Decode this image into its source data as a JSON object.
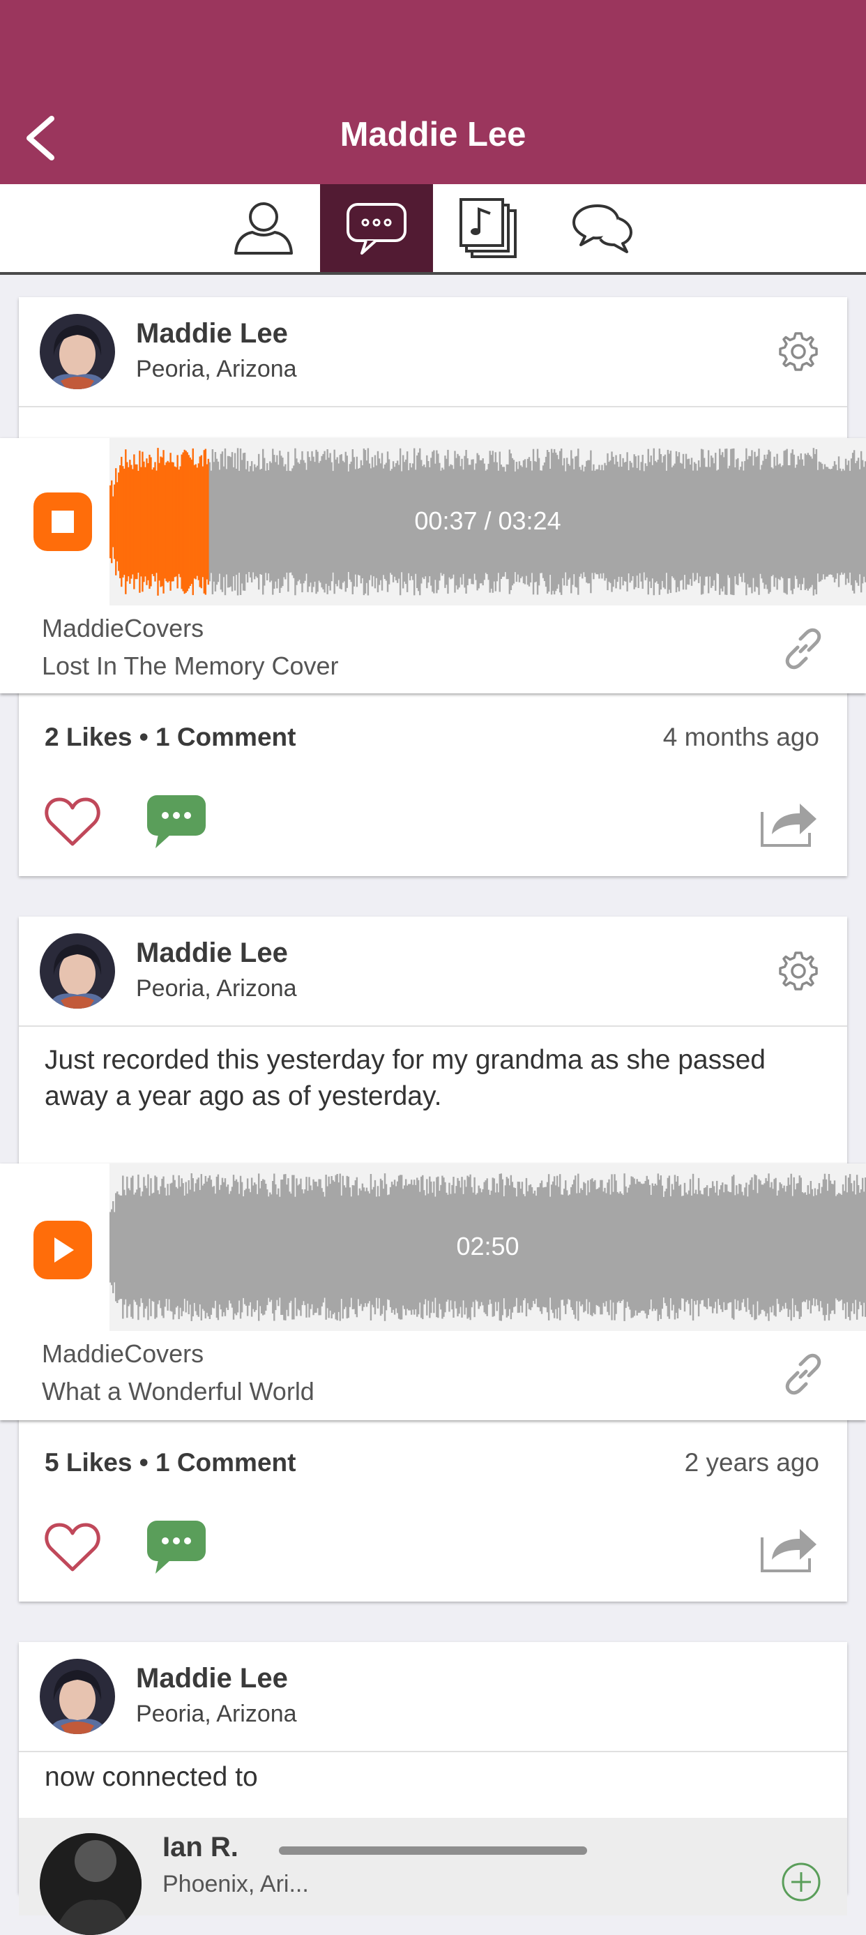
{
  "header": {
    "title": "Maddie Lee"
  },
  "tabs": [
    {
      "icon": "profile-icon"
    },
    {
      "icon": "speech-bubble-icon"
    },
    {
      "icon": "music-library-icon"
    },
    {
      "icon": "chat-bubbles-icon"
    }
  ],
  "posts": [
    {
      "author": "Maddie Lee",
      "location": "Peoria, Arizona",
      "audio": {
        "time": "00:37 / 03:24",
        "artist": "MaddieCovers",
        "title": "Lost In The Memory Cover",
        "state": "playing",
        "progress": 0.13
      },
      "stats": "2 Likes • 1 Comment",
      "time_ago": "4 months ago"
    },
    {
      "author": "Maddie Lee",
      "location": "Peoria, Arizona",
      "text": "Just recorded this yesterday for my grandma as she passed away a year ago as of yesterday.",
      "audio": {
        "time": "02:50",
        "artist": "MaddieCovers",
        "title": "What a Wonderful World",
        "state": "paused",
        "progress": 0
      },
      "stats": "5 Likes • 1 Comment",
      "time_ago": "2 years ago"
    },
    {
      "author": "Maddie Lee",
      "location": "Peoria, Arizona",
      "text": "now connected to",
      "connection": {
        "name": "Ian R.",
        "location": "Phoenix, Ari..."
      }
    }
  ],
  "colors": {
    "header": "#9b365d",
    "tab_active": "#521b33",
    "accent_orange": "#ff6d0a",
    "like": "#c0485a",
    "comment": "#5a9e5a",
    "wave": "#a6a6a6"
  }
}
